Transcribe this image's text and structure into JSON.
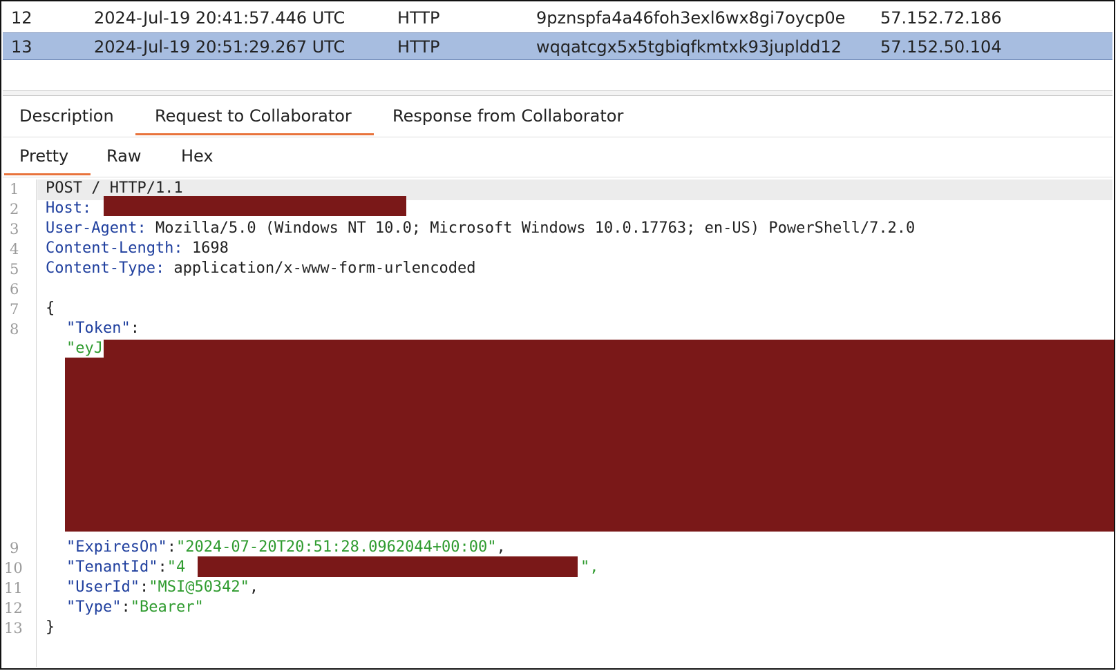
{
  "interactions": [
    {
      "num": "12",
      "time": "2024-Jul-19 20:41:57.446 UTC",
      "type": "HTTP",
      "payload": "9pznspfa4a46foh3exl6wx8gi7oycp0e",
      "ip": "57.152.72.186",
      "selected": false
    },
    {
      "num": "13",
      "time": "2024-Jul-19 20:51:29.267 UTC",
      "type": "HTTP",
      "payload": "wqqatcgx5x5tgbiqfkmtxk93jupldd12",
      "ip": "57.152.50.104",
      "selected": true
    }
  ],
  "main_tabs": [
    "Description",
    "Request to Collaborator",
    "Response from Collaborator"
  ],
  "sub_tabs": [
    "Pretty",
    "Raw",
    "Hex"
  ],
  "line_numbers": [
    "1",
    "2",
    "3",
    "4",
    "5",
    "6",
    "7",
    "8",
    "9",
    "10",
    "11",
    "12",
    "13"
  ],
  "request": {
    "request_line": "POST / HTTP/1.1",
    "host_key": "Host:",
    "ua_key": "User-Agent:",
    "ua_val": " Mozilla/5.0 (Windows NT 10.0; Microsoft Windows 10.0.17763; en-US) PowerShell/7.2.0",
    "cl_key": "Content-Length:",
    "cl_val": " 1698",
    "ct_key": "Content-Type:",
    "ct_val": " application/x-www-form-urlencoded",
    "brace_open": "{",
    "token_key": "\"Token\"",
    "token_colon": ":",
    "token_val_start": "\"eyJ",
    "expires_key": "\"ExpiresOn\"",
    "expires_val": "\"2024-07-20T20:51:28.0962044+00:00\"",
    "tenant_key": "\"TenantId\"",
    "tenant_val_start": "\"4",
    "tenant_val_end": "\",",
    "userid_key": "\"UserId\"",
    "userid_val": "\"MSI@50342\"",
    "type_key": "\"Type\"",
    "type_val": "\"Bearer\"",
    "colon": ":",
    "comma": ",",
    "brace_close": "}"
  },
  "colors": {
    "selection": "#a7bde0",
    "redaction": "#7a1818",
    "accent": "#e8733c",
    "key": "#1f3f9e",
    "string": "#2f9b2f"
  }
}
